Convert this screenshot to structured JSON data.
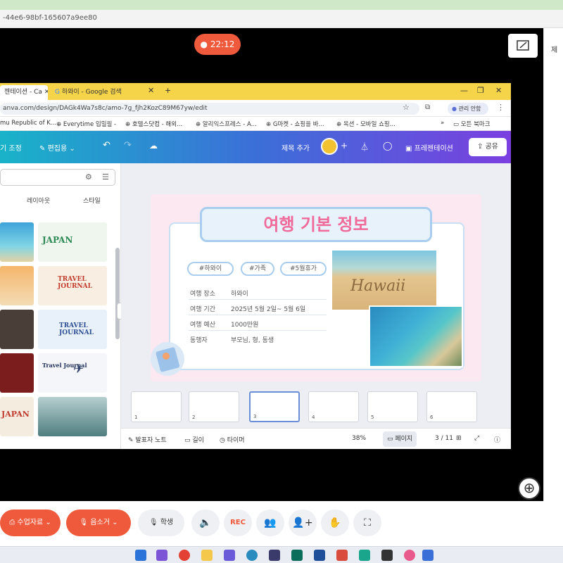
{
  "session": {
    "url_fragment": "-44e6-98bf-165607a9ee80",
    "timer": "22:12"
  },
  "browser": {
    "tab1": "젠테이션 - Ca",
    "tab2": "하와이 - Google 검색",
    "address": "anva.com/design/DAGk4Wa7s8c/amo-7g_fjh2KozC89M67yw/edit",
    "profile_label": "관리 안함",
    "bookmarks": [
      "mu Republic of K...",
      "Everytime 입밀필 -",
      "호텔스닷컴 - 해외...",
      "알리익스프레스 - A...",
      "G마켓 - 쇼핑을 바...",
      "옥션 - 모바일 쇼핑..."
    ],
    "bookmarks_all": "모든 북마크"
  },
  "canva": {
    "left_label": "기 조정",
    "edit_label": "편집용",
    "title_add": "제목 추가",
    "present_label": "프레젠테이션",
    "share_label": "공유",
    "panel_tabs": [
      "레이아웃",
      "스타일"
    ],
    "thumbnails": [
      "JAPAN",
      "TRAVEL JOURNAL",
      "TRAVEL JOURNAL",
      "Travel Journal",
      "JAPAN"
    ]
  },
  "slide": {
    "title": "여행 기본 정보",
    "hashtags": [
      "#하와이",
      "#가족",
      "#5월휴가"
    ],
    "rows": [
      {
        "k": "여행 장소",
        "v": "하와이"
      },
      {
        "k": "여행 기간",
        "v": "2025년 5월 2일~ 5월 6일"
      },
      {
        "k": "여행 예산",
        "v": "1000만원"
      },
      {
        "k": "동행자",
        "v": "부모님, 형, 동생"
      }
    ],
    "photo_text": "Hawaii"
  },
  "pages": [
    "1",
    "2",
    "3",
    "4",
    "5",
    "6"
  ],
  "footer": {
    "notes": "발표자 노트",
    "duration": "길이",
    "timer": "타이머",
    "zoom": "38%",
    "page_view": "페이지",
    "page_count": "3 / 11"
  },
  "controls": {
    "class_material": "수업자료",
    "sound": "음소거",
    "student": "학생"
  }
}
